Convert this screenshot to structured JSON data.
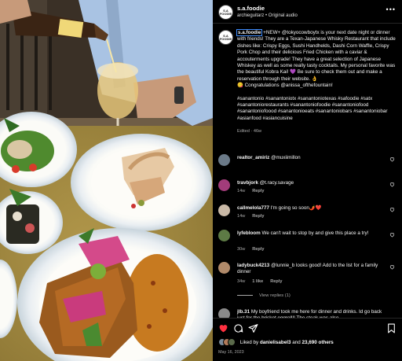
{
  "header": {
    "username": "s.a.foodie",
    "subtitle": "archieguitarz • Original audio",
    "more_icon": "more-horizontal-icon"
  },
  "caption": {
    "username": "s.a.foodie",
    "line1": "+NEW+ @tokyocowboytx is your next date night or dinner with friends! They are a Texan-Japanese Whisky Restaurant that include dishes like: Crispy Eggs, Sushi Handhelds, Dashi Corn Waffle, Crispy Pork Chop and their delicious Fried Chicken with a caviar & accouterments upgrade! They have a great selection of Japanese Whiskey as well as some really tasty cocktails. My personal favorite was the beautiful Kobra Kai! 💜 Be sure to check them out and make a reservation through their website. 👌",
    "line2": "😋 Congratulations @anissa_ofthefountain!",
    "hashtags": "#sanantonio #sanantoniotx #sanantoniotexas #safoodie #satx #sanantoniorestaurants #sanantoniofoodie #sanantoniofood #sanantoniofoood #sanantonioeats #sanantoniobars #sanantoniobar #asianfood #asiancuisine",
    "edited": "Edited · 46w"
  },
  "comments": [
    {
      "username": "realtor_amiriz",
      "text": "@muxiimillon",
      "time": "",
      "likes": "",
      "reply": "",
      "avatar_color": "#6b7a88"
    },
    {
      "username": "travbjork",
      "text": "@t.racy.savage",
      "time": "14w",
      "likes": "",
      "reply": "Reply",
      "avatar_color": "#a23c7a"
    },
    {
      "username": "callmelola777",
      "text": "I'm going so soon🌶️❤️",
      "time": "14w",
      "likes": "",
      "reply": "Reply",
      "avatar_color": "#c9b9a6"
    },
    {
      "username": "lyfebloom",
      "text": "We can't wait to stop by and give this place a try!",
      "time": "30w",
      "likes": "",
      "reply": "Reply",
      "avatar_color": "#5d7a45"
    },
    {
      "username": "ladybuck4213",
      "text": "@lunnie_b looks good! Add to the list for a family dinner",
      "time": "34w",
      "likes": "1 like",
      "reply": "Reply",
      "avatar_color": "#b08a6a"
    },
    {
      "username": "jlb.31",
      "text": "My boyfriend took me here for dinner and drinks. Id go back just for the brisket eggroll!! The steak was also",
      "time": "",
      "likes": "",
      "reply": "",
      "avatar_color": "#8a8a8a"
    }
  ],
  "view_replies": "View replies (1)",
  "actions": {
    "like_icon": "heart-filled-icon",
    "comment_icon": "comment-icon",
    "share_icon": "share-icon",
    "save_icon": "bookmark-icon",
    "like_color": "#ff3040"
  },
  "likes": {
    "prefix": "Liked by ",
    "user": "danielisabel3",
    "middle": " and ",
    "count": "23,690 others"
  },
  "date": "May 16, 2023"
}
